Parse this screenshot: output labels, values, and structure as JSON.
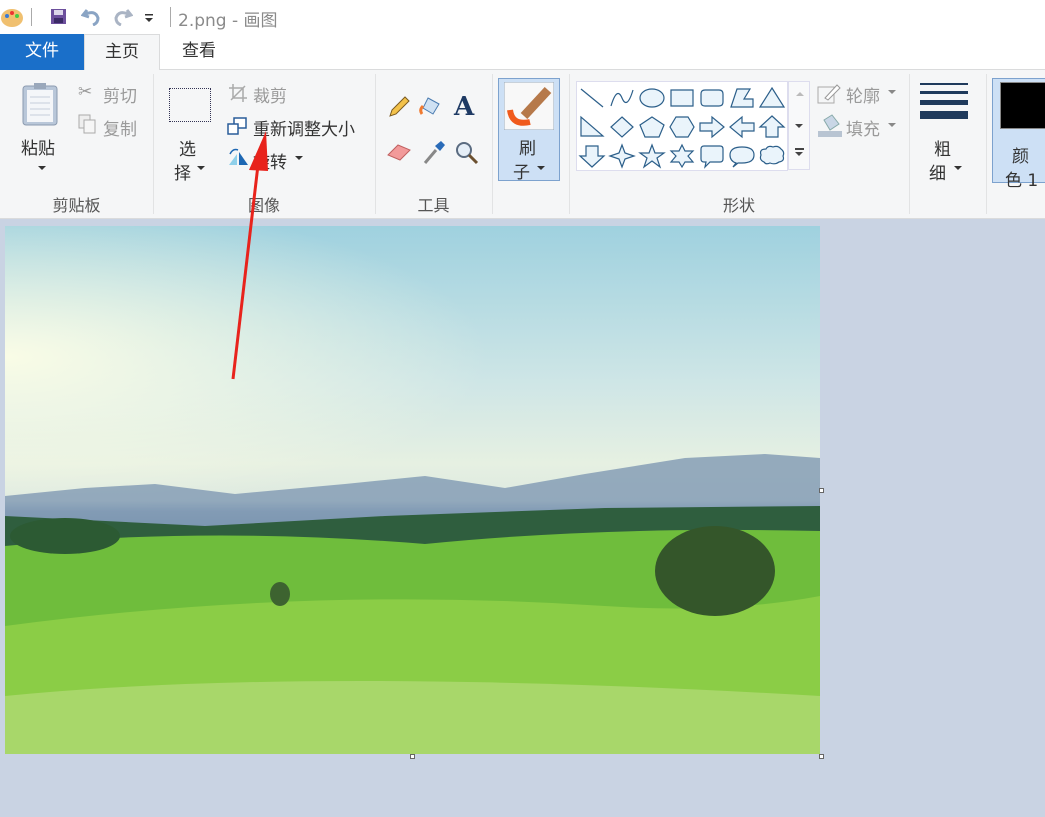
{
  "titlebar": {
    "title": "2.png - 画图",
    "icons": [
      "paint-app-icon",
      "save-icon",
      "undo-icon",
      "redo-icon",
      "customize-quick-access-icon"
    ]
  },
  "tabs": {
    "file": "文件",
    "home": "主页",
    "view": "查看"
  },
  "clipboard": {
    "paste": "粘贴",
    "cut": "剪切",
    "copy": "复制",
    "label": "剪贴板"
  },
  "image": {
    "select": "选",
    "select2": "择",
    "crop": "裁剪",
    "resize": "重新调整大小",
    "rotate": "旋转",
    "label": "图像"
  },
  "tools": {
    "label": "工具",
    "icons": [
      "pencil-icon",
      "fill-bucket-icon",
      "text-icon",
      "eraser-icon",
      "color-picker-icon",
      "magnifier-icon"
    ]
  },
  "brushes": {
    "line1": "刷",
    "line2": "子"
  },
  "shapes": {
    "label": "形状",
    "outline": "轮廓",
    "fill": "填充",
    "items": [
      "line",
      "curve",
      "oval",
      "rectangle",
      "rounded-rectangle",
      "polygon",
      "triangle",
      "right-triangle",
      "diamond",
      "pentagon",
      "hexagon",
      "right-arrow",
      "left-arrow",
      "up-arrow",
      "down-arrow",
      "four-point-star",
      "five-point-star",
      "six-point-star",
      "rounded-callout",
      "oval-callout",
      "cloud-callout"
    ]
  },
  "size": {
    "line1": "粗",
    "line2": "细"
  },
  "color1": {
    "line1": "颜",
    "line2": "色 1",
    "value": "#000000"
  },
  "annotation": {
    "arrow_color": "#e8231c"
  }
}
